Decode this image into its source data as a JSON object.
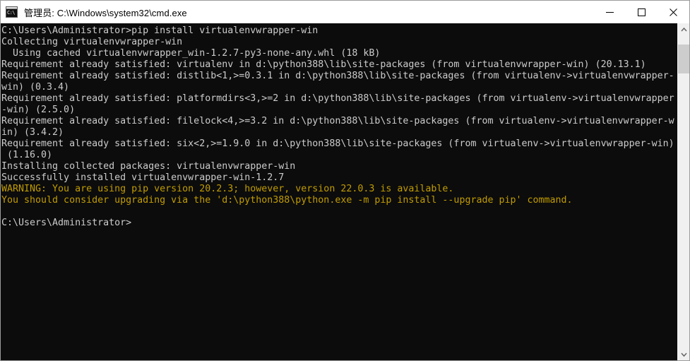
{
  "window": {
    "title": "管理员: C:\\Windows\\system32\\cmd.exe",
    "icon_name": "cmd-console-icon",
    "icon_glyph": "C:\\",
    "minimize_label": "最小化",
    "maximize_label": "最大化",
    "close_label": "关闭",
    "background_color": "#ffffff",
    "console_background": "#0c0c0c",
    "console_foreground": "#cccccc",
    "warning_color": "#c19c00"
  },
  "scrollbar": {
    "up_arrow_name": "scroll-up-arrow",
    "down_arrow_name": "scroll-down-arrow",
    "thumb_name": "scrollbar-thumb"
  },
  "console": {
    "lines": [
      {
        "text": "C:\\Users\\Administrator>pip install virtualenvwrapper-win",
        "color": "normal"
      },
      {
        "text": "Collecting virtualenvwrapper-win",
        "color": "normal"
      },
      {
        "text": "  Using cached virtualenvwrapper_win-1.2.7-py3-none-any.whl (18 kB)",
        "color": "normal"
      },
      {
        "text": "Requirement already satisfied: virtualenv in d:\\python388\\lib\\site-packages (from virtualenvwrapper-win) (20.13.1)",
        "color": "normal"
      },
      {
        "text": "Requirement already satisfied: distlib<1,>=0.3.1 in d:\\python388\\lib\\site-packages (from virtualenv->virtualenvwrapper-win) (0.3.4)",
        "color": "normal"
      },
      {
        "text": "Requirement already satisfied: platformdirs<3,>=2 in d:\\python388\\lib\\site-packages (from virtualenv->virtualenvwrapper-win) (2.5.0)",
        "color": "normal"
      },
      {
        "text": "Requirement already satisfied: filelock<4,>=3.2 in d:\\python388\\lib\\site-packages (from virtualenv->virtualenvwrapper-win) (3.4.2)",
        "color": "normal"
      },
      {
        "text": "Requirement already satisfied: six<2,>=1.9.0 in d:\\python388\\lib\\site-packages (from virtualenv->virtualenvwrapper-win) (1.16.0)",
        "color": "normal"
      },
      {
        "text": "Installing collected packages: virtualenvwrapper-win",
        "color": "normal"
      },
      {
        "text": "Successfully installed virtualenvwrapper-win-1.2.7",
        "color": "normal"
      },
      {
        "text": "WARNING: You are using pip version 20.2.3; however, version 22.0.3 is available.",
        "color": "warn"
      },
      {
        "text": "You should consider upgrading via the 'd:\\python388\\python.exe -m pip install --upgrade pip' command.",
        "color": "warn"
      },
      {
        "text": "",
        "color": "normal"
      },
      {
        "text": "C:\\Users\\Administrator>",
        "color": "normal"
      }
    ]
  }
}
